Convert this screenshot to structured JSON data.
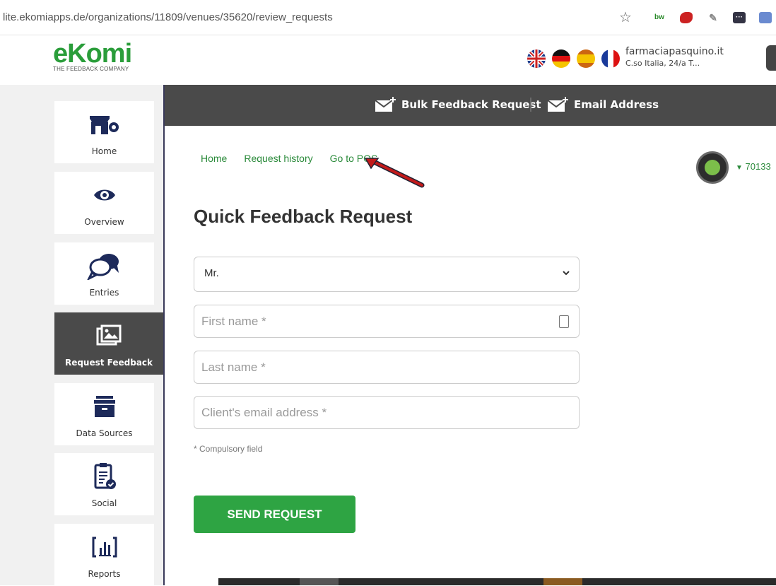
{
  "browser": {
    "url": "lite.ekomiapps.de/organizations/11809/venues/35620/review_requests",
    "extensions": [
      "bw"
    ]
  },
  "header": {
    "logo_word": "eKomi",
    "logo_tagline": "THE FEEDBACK COMPANY",
    "shop_name": "farmaciapasquino.it",
    "shop_address": "C.so Italia, 24/a T..."
  },
  "sidebar": {
    "items": [
      {
        "label": "Home"
      },
      {
        "label": "Overview"
      },
      {
        "label": "Entries"
      },
      {
        "label": "Request Feedback"
      },
      {
        "label": "Data Sources"
      },
      {
        "label": "Social"
      },
      {
        "label": "Reports"
      }
    ]
  },
  "topbar": {
    "bulk_label": "Bulk Feedback Request",
    "email_label": "Email Address"
  },
  "main": {
    "breadcrumbs": [
      "Home",
      "Request history",
      "Go to POS"
    ],
    "title": "Quick Feedback Request",
    "salutation_value": "Mr.",
    "first_name_placeholder": "First name *",
    "last_name_placeholder": "Last name *",
    "email_placeholder": "Client's email address *",
    "note": "* Compulsory field",
    "send_label": "SEND REQUEST",
    "score": "70133"
  },
  "colors": {
    "brand_green": "#2ea443",
    "dark_bar": "#4a4a4a"
  }
}
